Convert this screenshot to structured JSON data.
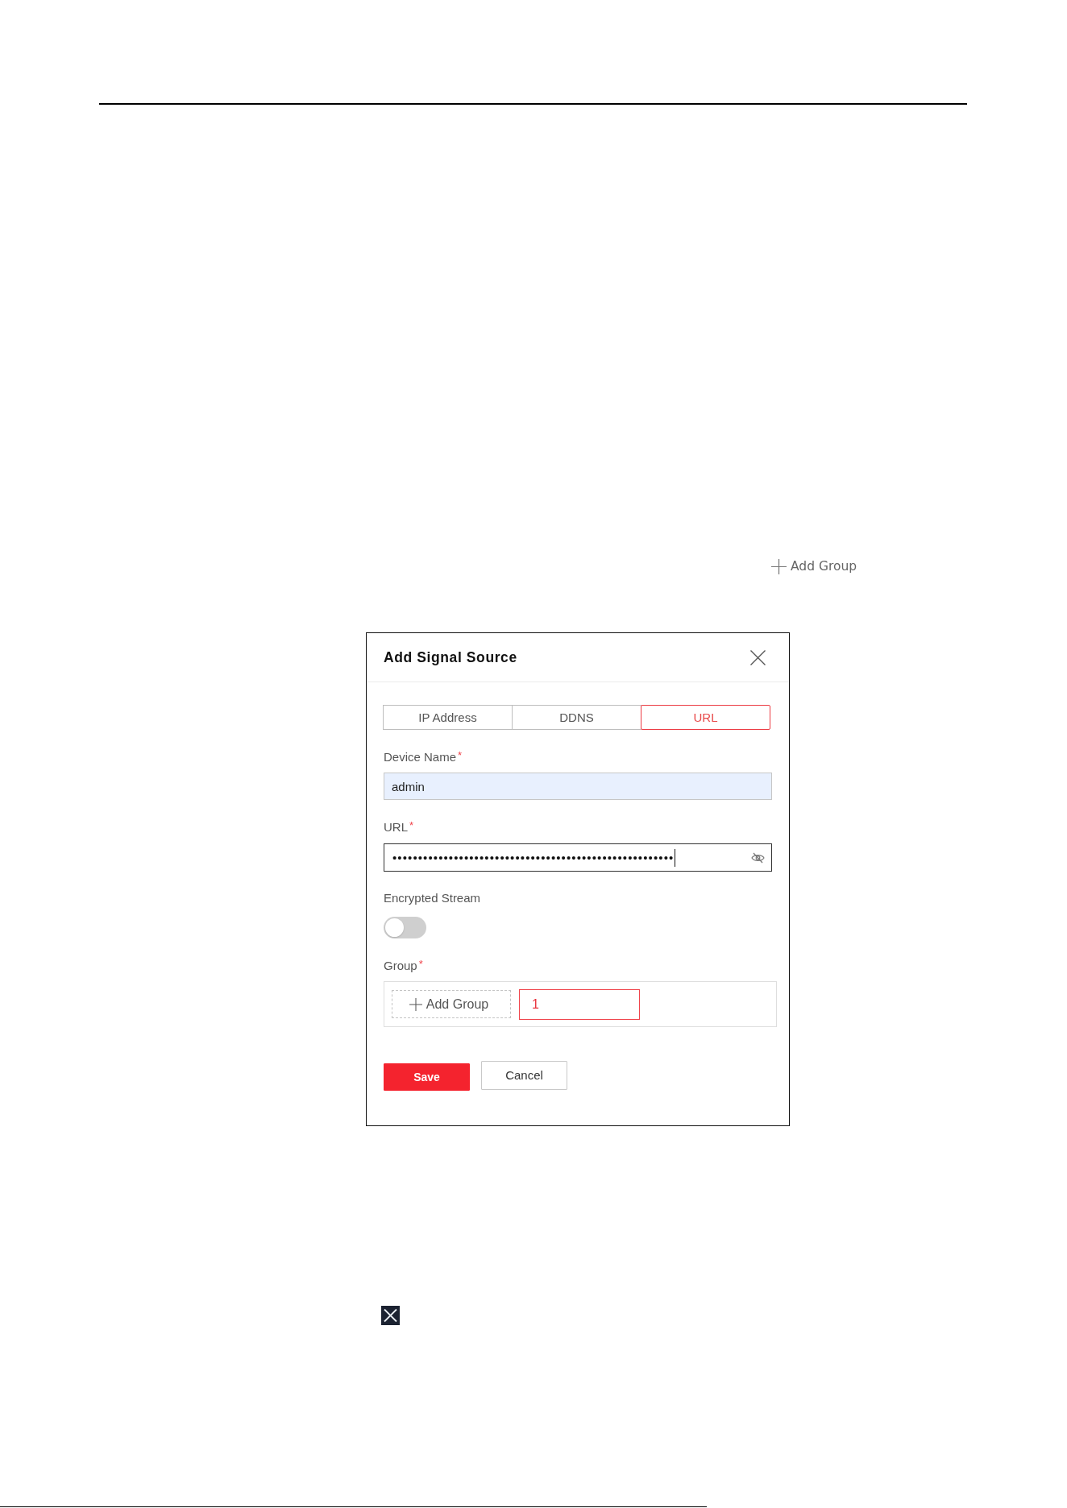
{
  "toolbar": {
    "add_group_label": "Add Group"
  },
  "dialog": {
    "title": "Add Signal Source",
    "tabs": [
      {
        "label": "IP Address",
        "selected": false
      },
      {
        "label": "DDNS",
        "selected": false
      },
      {
        "label": "URL",
        "selected": true
      }
    ],
    "fields": [
      {
        "kind": "text",
        "label": "Device Name",
        "required_mark": "*",
        "value": "admin",
        "autofilled": true
      },
      {
        "kind": "password",
        "label": "URL",
        "required_mark": "*",
        "value": "•••••••••••••••••••••••••••••••••••••••••••••••••••••••",
        "focused": true
      },
      {
        "kind": "toggle",
        "label": "Encrypted Stream",
        "on": false
      },
      {
        "kind": "groups",
        "label": "Group",
        "required_mark": "*",
        "add_label": "Add Group",
        "value": "1"
      }
    ],
    "buttons": [
      {
        "kind": "primary",
        "label": "Save"
      },
      {
        "kind": "secondary",
        "label": "Cancel"
      }
    ]
  }
}
